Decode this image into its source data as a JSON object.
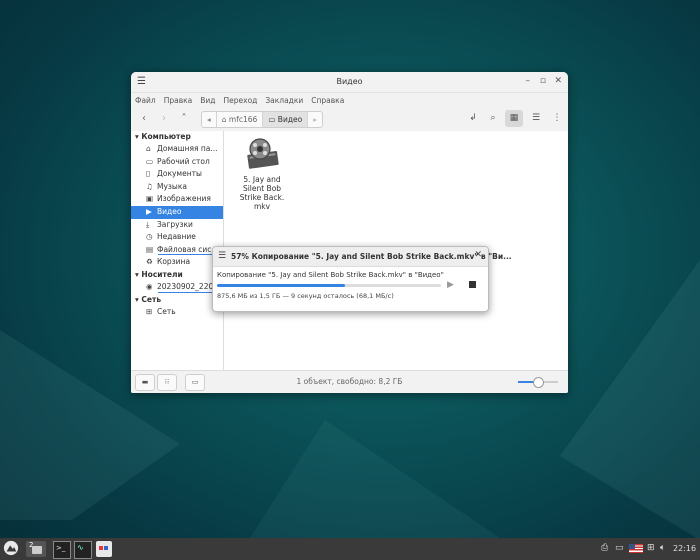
{
  "window": {
    "title": "Видео",
    "menu": [
      "Файл",
      "Правка",
      "Вид",
      "Переход",
      "Закладки",
      "Справка"
    ],
    "breadcrumbs": [
      "mfc166",
      "Видео"
    ]
  },
  "sidebar": {
    "sections": [
      {
        "header": "Компьютер",
        "items": [
          {
            "label": "Домашняя па...",
            "icon": "home-icon"
          },
          {
            "label": "Рабочий стол",
            "icon": "desktop-icon"
          },
          {
            "label": "Документы",
            "icon": "document-icon"
          },
          {
            "label": "Музыка",
            "icon": "music-icon"
          },
          {
            "label": "Изображения",
            "icon": "image-icon"
          },
          {
            "label": "Видео",
            "icon": "video-icon",
            "selected": true
          },
          {
            "label": "Загрузки",
            "icon": "download-icon"
          },
          {
            "label": "Недавние",
            "icon": "clock-icon"
          },
          {
            "label": "Файловая сис...",
            "icon": "drive-icon"
          },
          {
            "label": "Корзина",
            "icon": "trash-icon"
          }
        ]
      },
      {
        "header": "Носители",
        "items": [
          {
            "label": "20230902_220...",
            "icon": "disc-icon"
          }
        ]
      },
      {
        "header": "Сеть",
        "items": [
          {
            "label": "Сеть",
            "icon": "network-icon"
          }
        ]
      }
    ]
  },
  "files": [
    {
      "name": "5. Jay and Silent Bob Strike Back. mkv",
      "icon": "video-file-icon"
    }
  ],
  "status": {
    "text": "1 объект, свободно: 8,2 ГБ",
    "zoom_fraction": 0.5
  },
  "copy_dialog": {
    "title": "57% Копирование \"5. Jay and Silent Bob Strike Back.mkv\" в \"Ви...",
    "message": "Копирование \"5. Jay and Silent Bob Strike Back.mkv\" в \"Видео\"",
    "progress": 0.57,
    "details": "875,6 МБ из 1,5 ГБ — 9 секунд осталось (68,1 МБ/с)"
  },
  "panel": {
    "clock": "22:16",
    "workspace": "2"
  },
  "colors": {
    "accent": "#3584e4",
    "panel": "#3a3a3a"
  }
}
